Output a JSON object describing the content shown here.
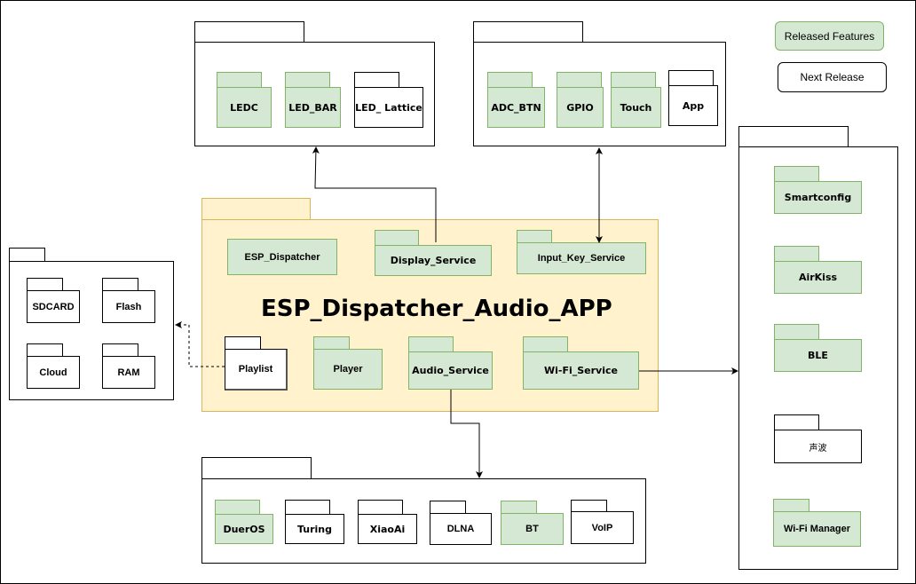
{
  "legend": {
    "released": "Released Features",
    "next": "Next Release",
    "colors": {
      "released_fill": "#d5e8d4",
      "released_border": "#82b366",
      "next_fill": "#ffffff",
      "next_border": "#000000"
    }
  },
  "app": {
    "title": "ESP_Dispatcher_Audio_APP",
    "fill": "#fff2cc",
    "border": "#d6b656",
    "components": [
      {
        "label": "ESP_Dispatcher",
        "status": "released"
      },
      {
        "label": "Display_Service",
        "status": "released"
      },
      {
        "label": "Input_Key_Service",
        "status": "released"
      },
      {
        "label": "Playlist",
        "status": "next"
      },
      {
        "label": "Player",
        "status": "released"
      },
      {
        "label": "Audio_Service",
        "status": "released"
      },
      {
        "label": "Wi-Fi_Service",
        "status": "released"
      }
    ]
  },
  "display_group": {
    "items": [
      {
        "label": "LEDC",
        "status": "released"
      },
      {
        "label": "LED_BAR",
        "status": "released"
      },
      {
        "label": "LED_ Lattice",
        "status": "next"
      }
    ]
  },
  "input_group": {
    "items": [
      {
        "label": "ADC_BTN",
        "status": "released"
      },
      {
        "label": "GPIO",
        "status": "released"
      },
      {
        "label": "Touch",
        "status": "released"
      },
      {
        "label": "App",
        "status": "next"
      }
    ]
  },
  "storage_group": {
    "items": [
      {
        "label": "SDCARD",
        "status": "next"
      },
      {
        "label": "Flash",
        "status": "next"
      },
      {
        "label": "Cloud",
        "status": "next"
      },
      {
        "label": "RAM",
        "status": "next"
      }
    ]
  },
  "audio_group": {
    "items": [
      {
        "label": "DuerOS",
        "status": "released"
      },
      {
        "label": "Turing",
        "status": "next"
      },
      {
        "label": "XiaoAi",
        "status": "next"
      },
      {
        "label": "DLNA",
        "status": "next"
      },
      {
        "label": "BT",
        "status": "released"
      },
      {
        "label": "VoIP",
        "status": "next"
      }
    ]
  },
  "wifi_group": {
    "items": [
      {
        "label": "Smartconfig",
        "status": "released"
      },
      {
        "label": "AirKiss",
        "status": "released"
      },
      {
        "label": "BLE",
        "status": "released"
      },
      {
        "label": "声波",
        "status": "next"
      },
      {
        "label": "Wi-Fi Manager",
        "status": "released"
      }
    ]
  },
  "connections": [
    {
      "from": "Display_Service",
      "to": "display_group",
      "style": "solid",
      "arrow": "end"
    },
    {
      "from": "Input_Key_Service",
      "to": "input_group",
      "style": "solid",
      "arrow": "both"
    },
    {
      "from": "Playlist",
      "to": "storage_group",
      "style": "dashed",
      "arrow": "end"
    },
    {
      "from": "Audio_Service",
      "to": "audio_group",
      "style": "solid",
      "arrow": "end"
    },
    {
      "from": "Wi-Fi_Service",
      "to": "wifi_group",
      "style": "solid",
      "arrow": "end"
    }
  ]
}
